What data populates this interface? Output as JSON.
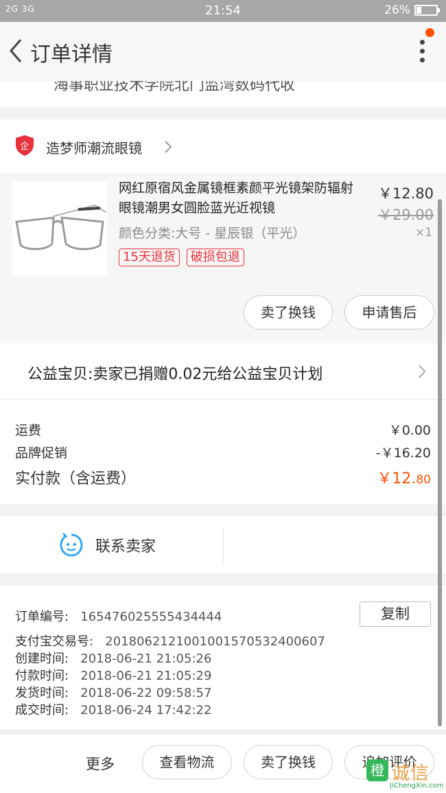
{
  "status_bar": {
    "signal": "2G 3G",
    "time": "21:54",
    "battery": "26%",
    "battery_level": 0.26
  },
  "nav": {
    "title": "订单详情"
  },
  "address_tail": "海事职业技术学院北门监湾数码代收",
  "shop": {
    "badge": "企",
    "name": "造梦师潮流眼镜"
  },
  "item": {
    "title": "网红原宿风金属镜框素颜平光镜架防辐射眼镜潮男女圆脸蓝光近视镜",
    "sku": "颜色分类:大号 - 星辰银（平光）",
    "tags": [
      "15天退货",
      "破损包退"
    ],
    "price": "￥12.80",
    "original_price": "￥29.00",
    "quantity": "×1",
    "buttons": [
      "卖了换钱",
      "申请售后"
    ]
  },
  "charity": "公益宝贝:卖家已捐赠0.02元给公益宝贝计划",
  "fees": {
    "shipping_label": "运费",
    "shipping_value": "￥0.00",
    "promo_label": "品牌促销",
    "promo_value": "-￥16.20",
    "total_label": "实付款（含运费）",
    "total_main": "￥12.",
    "total_cents": "80"
  },
  "contact": {
    "label": "联系卖家"
  },
  "order_info": {
    "order_no_label": "订单编号:",
    "order_no": "165476025555434444",
    "copy_label": "复制",
    "alipay_label": "支付宝交易号:",
    "alipay_no": "2018062121001001570532400607",
    "created_label": "创建时间:",
    "created": "2018-06-21 21:05:26",
    "paid_label": "付款时间:",
    "paid": "2018-06-21 21:05:29",
    "shipped_label": "发货时间:",
    "shipped": "2018-06-22 09:58:57",
    "closed_label": "成交时间:",
    "closed": "2018-06-24 17:42:22"
  },
  "bottom_bar": {
    "more": "更多",
    "buttons": [
      "查看物流",
      "卖了换钱",
      "追加评价"
    ]
  },
  "watermark": {
    "logo": "橙",
    "text": "诚信",
    "url": "JiChengXin.com"
  },
  "colors": {
    "accent": "#ff5000",
    "tag_red": "#e8323c",
    "status_bar": "#a7a7a7"
  }
}
